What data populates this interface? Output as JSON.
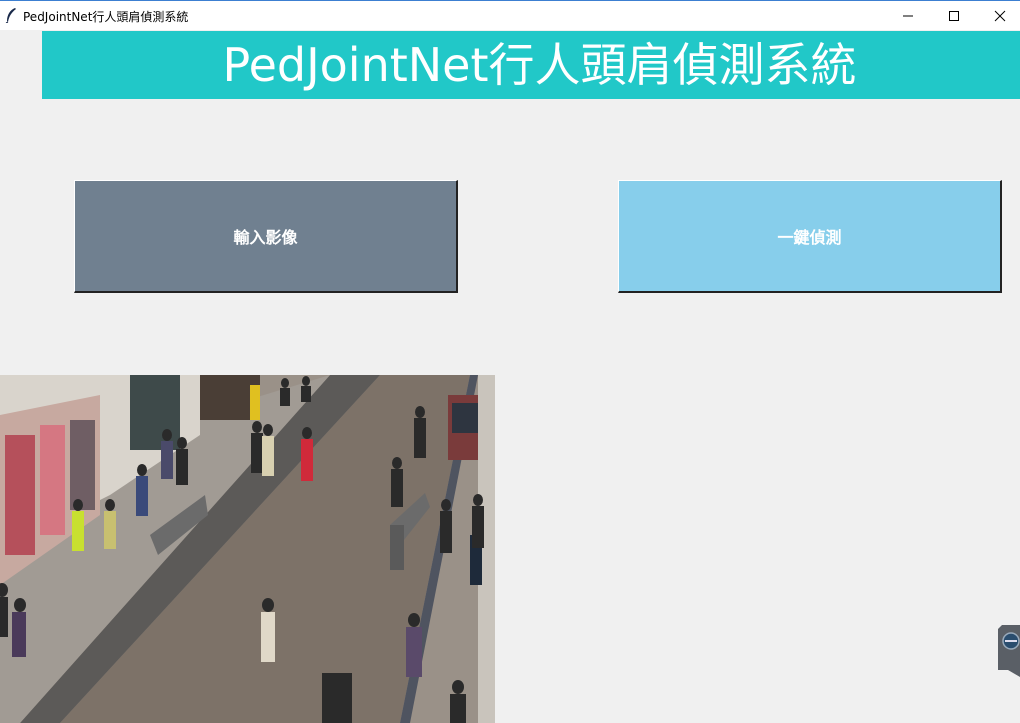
{
  "window": {
    "title": "PedJointNet行人頭肩偵測系統",
    "minimize_icon": "minimize-icon",
    "maximize_icon": "maximize-icon",
    "close_icon": "close-icon"
  },
  "header": {
    "title": "PedJointNet行人頭肩偵測系統",
    "background_color": "#21c8c8"
  },
  "actions": {
    "input_image_label": "輸入影像",
    "input_image_color": "#708090",
    "detect_label": "一鍵偵測",
    "detect_color": "#87ceeb"
  },
  "image_panel": {
    "description_icon": "street-pedestrian-photo"
  }
}
